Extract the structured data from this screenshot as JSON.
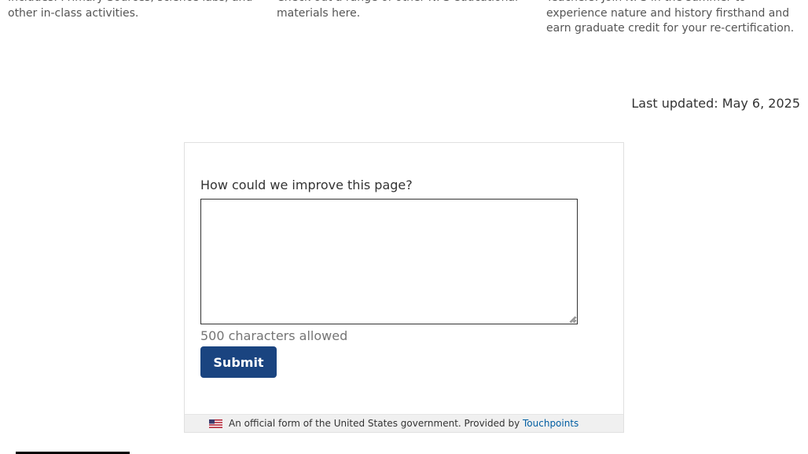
{
  "cards": [
    {
      "text": "Includes: Primary Sources, science labs, and other in-class activities."
    },
    {
      "text": "Check out a range of other NPS educational materials here."
    },
    {
      "text": "Teachers: Join NPS in the summer to experience nature and history firsthand and earn graduate credit for your re-certification."
    }
  ],
  "last_updated": "Last updated: May 6, 2025",
  "feedback": {
    "question": "How could we improve this page?",
    "textarea_value": "",
    "char_limit_text": "500 characters allowed",
    "submit_label": "Submit",
    "footer_text": "An official form of the United States government. Provided by",
    "footer_link_text": "Touchpoints"
  },
  "colors": {
    "submit_button": "#1a4480",
    "link": "#005ea2",
    "footer_background": "#f0f0f0"
  },
  "icons": {
    "flag": "us-flag-icon",
    "resize": "resize-grip-icon"
  }
}
